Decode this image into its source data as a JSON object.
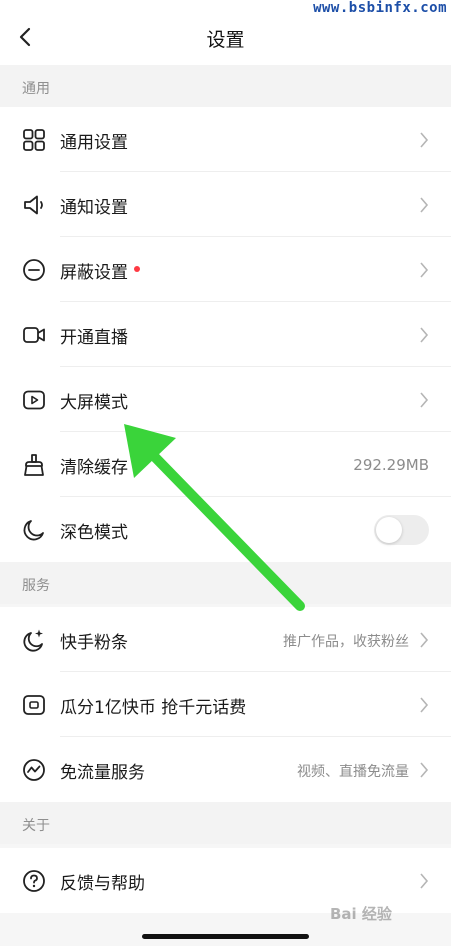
{
  "watermark": "www.bsbinfx.com",
  "header": {
    "title": "设置"
  },
  "sections": {
    "general": "通用",
    "service": "服务",
    "about": "关于"
  },
  "rows": {
    "general_settings": {
      "label": "通用设置"
    },
    "notify_settings": {
      "label": "通知设置"
    },
    "block_settings": {
      "label": "屏蔽设置"
    },
    "live": {
      "label": "开通直播"
    },
    "bigscreen": {
      "label": "大屏模式"
    },
    "cache": {
      "label": "清除缓存",
      "value": "292.29MB"
    },
    "dark": {
      "label": "深色模式",
      "toggle_on": false
    },
    "fans": {
      "label": "快手粉条",
      "value": "推广作品，收获粉丝"
    },
    "coins": {
      "label": "瓜分1亿快币 抢千元话费"
    },
    "freeflow": {
      "label": "免流量服务",
      "value": "视频、直播免流量"
    },
    "feedback": {
      "label": "反馈与帮助"
    }
  },
  "colors": {
    "accent_dot": "#fe3a43",
    "annotation_arrow": "#3ad43a"
  },
  "bottom_watermark": "Bai  经验"
}
